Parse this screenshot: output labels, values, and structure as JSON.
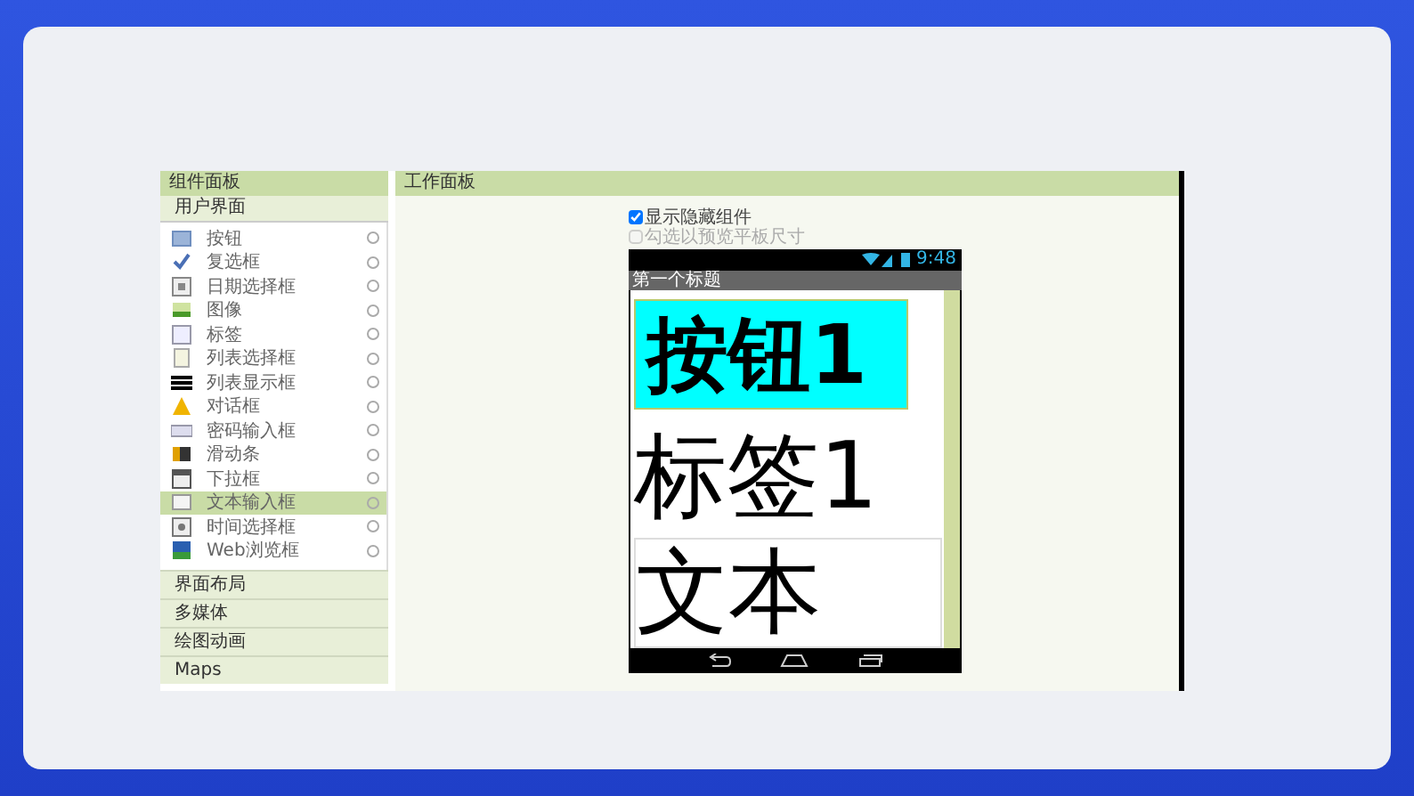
{
  "palette": {
    "title": "组件面板",
    "section": "用户界面",
    "items": [
      {
        "label": "按钮",
        "kind": "button",
        "selected": false
      },
      {
        "label": "复选框",
        "kind": "checkbox",
        "selected": false
      },
      {
        "label": "日期选择框",
        "kind": "datepicker",
        "selected": false
      },
      {
        "label": "图像",
        "kind": "image",
        "selected": false
      },
      {
        "label": "标签",
        "kind": "label",
        "selected": false
      },
      {
        "label": "列表选择框",
        "kind": "listpicker",
        "selected": false
      },
      {
        "label": "列表显示框",
        "kind": "listview",
        "selected": false
      },
      {
        "label": "对话框",
        "kind": "notifier",
        "selected": false
      },
      {
        "label": "密码输入框",
        "kind": "password",
        "selected": false
      },
      {
        "label": "滑动条",
        "kind": "slider",
        "selected": false
      },
      {
        "label": "下拉框",
        "kind": "spinner",
        "selected": false
      },
      {
        "label": "文本输入框",
        "kind": "textbox",
        "selected": true
      },
      {
        "label": "时间选择框",
        "kind": "timepicker",
        "selected": false
      },
      {
        "label": "Web浏览框",
        "kind": "webviewer",
        "selected": false
      }
    ],
    "categories": [
      "界面布局",
      "多媒体",
      "绘图动画",
      "Maps"
    ]
  },
  "viewer": {
    "title": "工作面板",
    "options": [
      {
        "label": "显示隐藏组件",
        "checked": true,
        "disabled": false
      },
      {
        "label": "勾选以预览平板尺寸",
        "checked": false,
        "disabled": true
      }
    ],
    "phone": {
      "time": "9:48",
      "screen_title": "第一个标题",
      "button": "按钮1",
      "label": "标签1",
      "textbox": "文本"
    }
  }
}
